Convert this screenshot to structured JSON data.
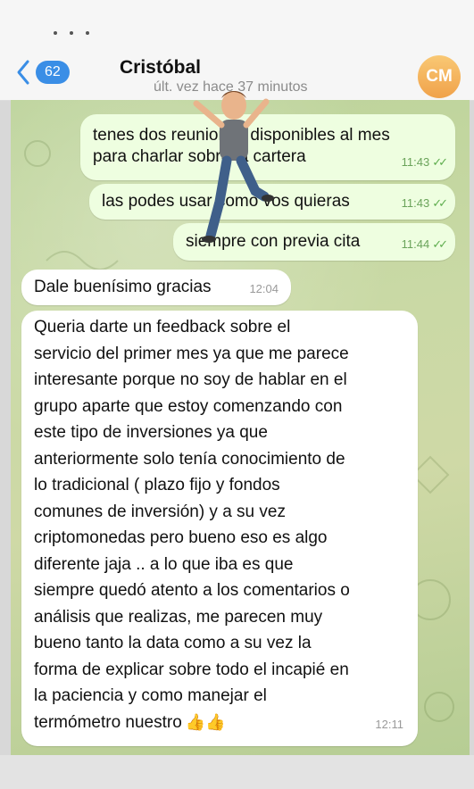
{
  "header": {
    "back_badge": "62",
    "contact_name": "Cristóbal",
    "last_seen": "últ. vez hace 37 minutos",
    "avatar_initials": "CM"
  },
  "messages": [
    {
      "dir": "out",
      "text": "tenes dos reuniones disponibles al mes\npara charlar sobre la cartera",
      "time": "11:43",
      "read": true
    },
    {
      "dir": "out",
      "text": "las podes usar como vos quieras",
      "time": "11:43",
      "read": true
    },
    {
      "dir": "out",
      "text": "siempre con previa cita",
      "time": "11:44",
      "read": true
    },
    {
      "dir": "in",
      "text": "Dale buenísimo gracias",
      "time": "12:04"
    },
    {
      "dir": "in",
      "text": "Queria darte un feedback sobre el\nservicio del primer mes ya que me parece\ninteresante porque no soy de hablar en el\ngrupo aparte que estoy comenzando con\neste tipo de inversiones ya que\nanteriormente solo tenía conocimiento de\nlo tradicional ( plazo fijo y fondos\ncomunes de inversión) y a su vez\ncriptomonedas pero bueno eso es algo\ndiferente jaja .. a lo que iba es que\nsiempre quedó atento a los comentarios o\nanálisis que realizas, me parecen muy\nbueno tanto la data como a su vez la\nforma de explicar sobre todo el incapié en\nla paciencia y como manejar el\ntermómetro nuestro",
      "emoji": "👍👍",
      "time": "12:11"
    }
  ],
  "colors": {
    "outgoing_bubble": "#eefee0",
    "incoming_bubble": "#ffffff",
    "badge": "#3a8ee6",
    "avatar": "#f0a24a",
    "read_tick": "#5fae4f"
  },
  "icons": [
    "back-chevron-icon",
    "double-check-icon",
    "thumbs-up-emoji",
    "dancing-avatar-sticker"
  ]
}
